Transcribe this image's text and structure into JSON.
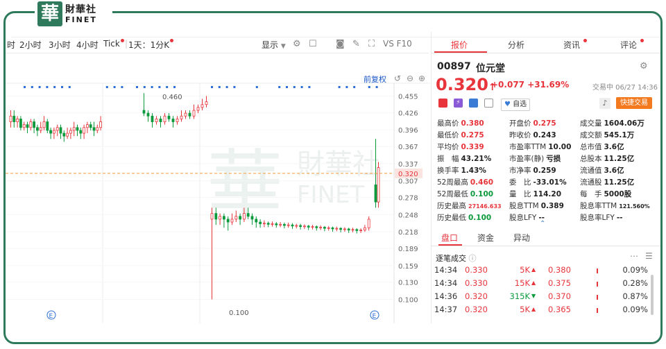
{
  "brand": {
    "mark": "華",
    "cn": "財華社",
    "en": "FINET"
  },
  "toolbar": {
    "items": [
      "时",
      "2小时",
      "3小时",
      "4小时",
      "Tick"
    ],
    "interval": "1天：1分K",
    "display": "显示",
    "vs_label": "VS F10"
  },
  "chart": {
    "fuquan": "前复权",
    "hi_label": "0.460",
    "lo_label": "0.100",
    "price_line_label": "0.320",
    "event_marker": "E",
    "watermark_cn": "財華社",
    "watermark_en": "FINET"
  },
  "chart_data": {
    "type": "candlestick",
    "ylim": [
      0.08,
      0.47
    ],
    "y_ticks": [
      "0.455",
      "0.426",
      "0.396",
      "0.367",
      "0.337",
      "0.307",
      "0.278",
      "0.248",
      "0.218",
      "0.189",
      "0.159",
      "0.130",
      "0.100"
    ],
    "current_price": 0.32,
    "segments": [
      {
        "name": "前收",
        "candles": [
          [
            0.41,
            0.42,
            0.43,
            0.4
          ],
          [
            0.42,
            0.41,
            0.43,
            0.4
          ],
          [
            0.41,
            0.415,
            0.42,
            0.4
          ],
          [
            0.415,
            0.4,
            0.42,
            0.395
          ],
          [
            0.4,
            0.405,
            0.41,
            0.395
          ],
          [
            0.405,
            0.4,
            0.41,
            0.39
          ],
          [
            0.4,
            0.41,
            0.415,
            0.395
          ],
          [
            0.41,
            0.4,
            0.415,
            0.39
          ],
          [
            0.4,
            0.395,
            0.405,
            0.385
          ],
          [
            0.395,
            0.4,
            0.41,
            0.39
          ],
          [
            0.4,
            0.41,
            0.42,
            0.395
          ],
          [
            0.41,
            0.395,
            0.415,
            0.39
          ],
          [
            0.395,
            0.39,
            0.4,
            0.38
          ],
          [
            0.39,
            0.395,
            0.4,
            0.38
          ],
          [
            0.395,
            0.4,
            0.405,
            0.385
          ],
          [
            0.4,
            0.39,
            0.405,
            0.38
          ],
          [
            0.39,
            0.385,
            0.395,
            0.375
          ],
          [
            0.385,
            0.39,
            0.4,
            0.38
          ],
          [
            0.39,
            0.395,
            0.4,
            0.38
          ],
          [
            0.395,
            0.4,
            0.41,
            0.385
          ],
          [
            0.4,
            0.395,
            0.405,
            0.385
          ],
          [
            0.395,
            0.39,
            0.4,
            0.38
          ],
          [
            0.39,
            0.4,
            0.405,
            0.38
          ],
          [
            0.4,
            0.405,
            0.41,
            0.39
          ],
          [
            0.405,
            0.4,
            0.41,
            0.395
          ],
          [
            0.4,
            0.395,
            0.41,
            0.385
          ],
          [
            0.395,
            0.4,
            0.405,
            0.39
          ],
          [
            0.4,
            0.41,
            0.42,
            0.395
          ]
        ]
      },
      {
        "name": "mid",
        "candles": [
          [
            0.43,
            0.425,
            0.46,
            0.42
          ],
          [
            0.425,
            0.42,
            0.43,
            0.41
          ],
          [
            0.42,
            0.41,
            0.425,
            0.4
          ],
          [
            0.41,
            0.415,
            0.42,
            0.405
          ],
          [
            0.415,
            0.41,
            0.42,
            0.4
          ],
          [
            0.41,
            0.42,
            0.425,
            0.405
          ],
          [
            0.42,
            0.415,
            0.425,
            0.41
          ],
          [
            0.415,
            0.41,
            0.42,
            0.4
          ],
          [
            0.41,
            0.415,
            0.42,
            0.405
          ],
          [
            0.415,
            0.42,
            0.43,
            0.41
          ],
          [
            0.42,
            0.425,
            0.43,
            0.415
          ],
          [
            0.425,
            0.42,
            0.43,
            0.415
          ],
          [
            0.42,
            0.43,
            0.44,
            0.415
          ],
          [
            0.43,
            0.435,
            0.44,
            0.425
          ],
          [
            0.435,
            0.44,
            0.45,
            0.43
          ],
          [
            0.44,
            0.445,
            0.455,
            0.435
          ]
        ]
      },
      {
        "name": "halt",
        "candles": [
          [
            0.24,
            0.25,
            0.26,
            0.1
          ],
          [
            0.25,
            0.24,
            0.26,
            0.23
          ],
          [
            0.24,
            0.245,
            0.25,
            0.23
          ],
          [
            0.245,
            0.24,
            0.25,
            0.225
          ],
          [
            0.24,
            0.235,
            0.245,
            0.22
          ],
          [
            0.235,
            0.24,
            0.25,
            0.23
          ],
          [
            0.24,
            0.245,
            0.255,
            0.235
          ],
          [
            0.245,
            0.24,
            0.25,
            0.23
          ],
          [
            0.24,
            0.25,
            0.26,
            0.235
          ],
          [
            0.25,
            0.245,
            0.26,
            0.24
          ],
          [
            0.245,
            0.24,
            0.25,
            0.23
          ],
          [
            0.24,
            0.235,
            0.245,
            0.225
          ],
          [
            0.235,
            0.232,
            0.24,
            0.225
          ],
          [
            0.232,
            0.233,
            0.238,
            0.226
          ],
          [
            0.233,
            0.231,
            0.236,
            0.226
          ],
          [
            0.231,
            0.232,
            0.236,
            0.227
          ],
          [
            0.232,
            0.23,
            0.235,
            0.225
          ],
          [
            0.23,
            0.231,
            0.235,
            0.226
          ],
          [
            0.231,
            0.229,
            0.234,
            0.224
          ],
          [
            0.229,
            0.23,
            0.234,
            0.225
          ],
          [
            0.23,
            0.228,
            0.233,
            0.223
          ],
          [
            0.228,
            0.229,
            0.232,
            0.224
          ],
          [
            0.229,
            0.227,
            0.232,
            0.222
          ],
          [
            0.227,
            0.228,
            0.231,
            0.223
          ],
          [
            0.228,
            0.226,
            0.23,
            0.221
          ],
          [
            0.226,
            0.227,
            0.23,
            0.222
          ],
          [
            0.227,
            0.225,
            0.229,
            0.22
          ],
          [
            0.225,
            0.226,
            0.229,
            0.221
          ],
          [
            0.226,
            0.224,
            0.228,
            0.219
          ],
          [
            0.224,
            0.225,
            0.228,
            0.22
          ],
          [
            0.225,
            0.223,
            0.227,
            0.218
          ],
          [
            0.223,
            0.224,
            0.227,
            0.219
          ],
          [
            0.224,
            0.222,
            0.226,
            0.217
          ],
          [
            0.222,
            0.223,
            0.226,
            0.218
          ],
          [
            0.223,
            0.221,
            0.225,
            0.216
          ],
          [
            0.221,
            0.222,
            0.225,
            0.217
          ],
          [
            0.222,
            0.22,
            0.224,
            0.215
          ],
          [
            0.22,
            0.221,
            0.224,
            0.216
          ],
          [
            0.221,
            0.225,
            0.23,
            0.218
          ],
          [
            0.225,
            0.24,
            0.245,
            0.22
          ]
        ]
      },
      {
        "name": "today",
        "candles": [
          [
            0.3,
            0.27,
            0.38,
            0.26
          ],
          [
            0.27,
            0.33,
            0.34,
            0.26
          ]
        ]
      }
    ]
  },
  "panel": {
    "tabs": [
      "报价",
      "分析",
      "资讯",
      "评论"
    ],
    "code": "00897",
    "name": "位元堂",
    "price": "0.320",
    "change": "+0.077",
    "change_pct": "+31.69%",
    "status": "交易中 06/27 14:36",
    "watch_label": "自选",
    "quick_trade": "快捷交易",
    "stats": [
      [
        [
          "最高价",
          "0.380",
          "red"
        ],
        [
          "开盘价",
          "0.275",
          "red"
        ],
        [
          "成交量",
          "1604.06万",
          "dark"
        ]
      ],
      [
        [
          "最低价",
          "0.275",
          "red"
        ],
        [
          "昨收价",
          "0.243",
          "dark"
        ],
        [
          "成交额",
          "545.1万",
          "dark"
        ]
      ],
      [
        [
          "平均价",
          "0.339",
          "red"
        ],
        [
          "市盈率TTM",
          "10.00",
          "dark"
        ],
        [
          "总市值",
          "3.6亿",
          "dark"
        ]
      ],
      [
        [
          "振　幅",
          "43.21%",
          "dark"
        ],
        [
          "市盈率(静)",
          "亏损",
          "dark"
        ],
        [
          "总股本",
          "11.25亿",
          "dark"
        ]
      ],
      [
        [
          "换手率",
          "1.43%",
          "dark"
        ],
        [
          "市净率",
          "0.259",
          "dark"
        ],
        [
          "流通值",
          "3.6亿",
          "dark"
        ]
      ],
      [
        [
          "52周最高",
          "0.460",
          "red"
        ],
        [
          "委　比",
          "-33.01%",
          "dark"
        ],
        [
          "流通股",
          "11.25亿",
          "dark"
        ]
      ],
      [
        [
          "52周最低",
          "0.100",
          "green"
        ],
        [
          "量　比",
          "114.20",
          "dark"
        ],
        [
          "每　手",
          "5000股",
          "dark"
        ]
      ],
      [
        [
          "历史最高",
          "27146.633",
          "red"
        ],
        [
          "股息TTM",
          "0.389",
          "dark"
        ],
        [
          "股息率TTM",
          "121.560%",
          "dark"
        ]
      ],
      [
        [
          "历史最低",
          "0.100",
          "green"
        ],
        [
          "股息LFY",
          "--",
          "dark"
        ],
        [
          "股息率LFY",
          "--",
          "dark"
        ]
      ]
    ],
    "bottom_tabs": [
      "盘口",
      "资金",
      "异动"
    ],
    "trades_title": "逐笔成交",
    "trades": [
      {
        "time": "14:34",
        "price": "0.330",
        "vol": "5K",
        "dir": "up",
        "lvl": "0.380",
        "pct": "0.09%"
      },
      {
        "time": "14:34",
        "price": "0.330",
        "vol": "15K",
        "dir": "up",
        "lvl": "0.375",
        "pct": "0.28%"
      },
      {
        "time": "14:36",
        "price": "0.320",
        "vol": "315K",
        "dir": "down",
        "lvl": "0.370",
        "pct": "0.87%"
      },
      {
        "time": "14:37",
        "price": "0.320",
        "vol": "5K",
        "dir": "up",
        "lvl": "0.365",
        "pct": "0.09%"
      }
    ]
  }
}
